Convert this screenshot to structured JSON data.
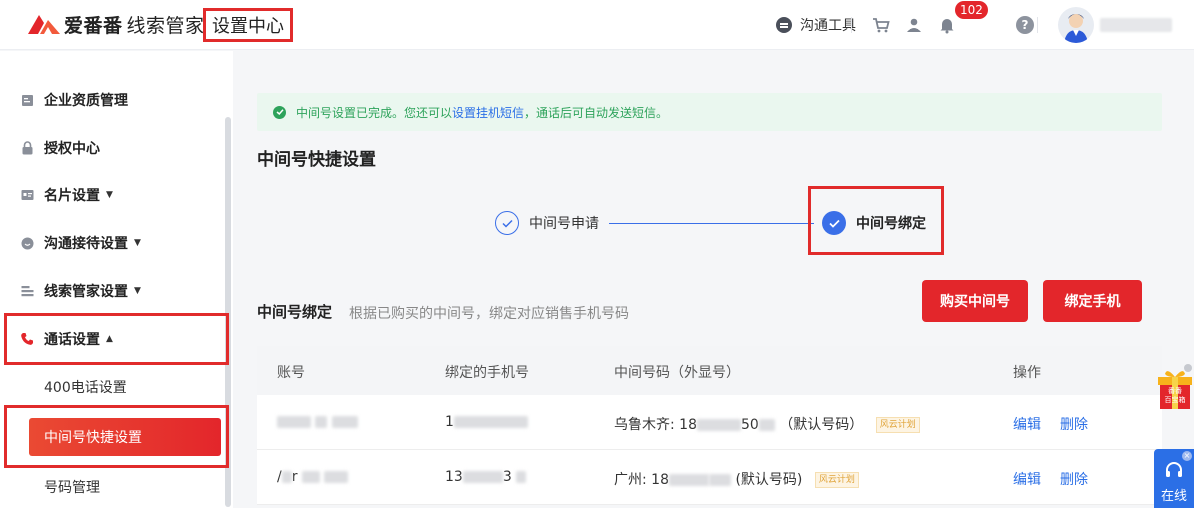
{
  "header": {
    "brand": "爱番番",
    "product": "线索管家",
    "section": "设置中心",
    "comm_tool": "沟通工具",
    "bell_badge": "102",
    "help": "?"
  },
  "sidebar": {
    "items": [
      {
        "label": "企业资质管理"
      },
      {
        "label": "授权中心"
      },
      {
        "label": "名片设置",
        "arrow": "▼"
      },
      {
        "label": "沟通接待设置",
        "arrow": "▼"
      },
      {
        "label": "线索管家设置",
        "arrow": "▼"
      },
      {
        "label": "通话设置",
        "arrow": "▲"
      }
    ],
    "sub_items": [
      {
        "label": "400电话设置"
      },
      {
        "label": "中间号快捷设置"
      },
      {
        "label": "号码管理"
      }
    ],
    "accent_color": "#e3262b"
  },
  "main": {
    "notice": {
      "prefix": "中间号设置已完成。您还可以",
      "link": "设置挂机短信",
      "suffix": "，通话后可自动发送短信。"
    },
    "title": "中间号快捷设置",
    "steps": [
      {
        "label": "中间号申请",
        "state": "done"
      },
      {
        "label": "中间号绑定",
        "state": "active"
      }
    ],
    "bind": {
      "title": "中间号绑定",
      "desc": "根据已购买的中间号，绑定对应销售手机号码",
      "buy_button": "购买中间号",
      "bind_button": "绑定手机"
    },
    "table": {
      "headers": [
        "账号",
        "绑定的手机号",
        "中间号码（外显号）",
        "操作"
      ],
      "rows": [
        {
          "phone_prefix": "1",
          "number_prefix": "乌鲁木齐: 18",
          "number_mid": "50",
          "default": "（默认号码）",
          "tag": "风云计划",
          "edit": "编辑",
          "delete": "删除"
        },
        {
          "account_prefix": "/",
          "account_mid": "r",
          "phone_prefix": "13",
          "phone_mid": "3",
          "number_prefix": "广州: 18",
          "default": "(默认号码)",
          "tag": "风云计划",
          "edit": "编辑",
          "delete": "删除"
        }
      ]
    }
  },
  "floating": {
    "gift_line1": "番番",
    "gift_line2": "百宝箱",
    "online": "在线"
  },
  "colors": {
    "primary_red": "#e3262b",
    "link_blue": "#2b6fe6",
    "success_green": "#2ea35b"
  }
}
